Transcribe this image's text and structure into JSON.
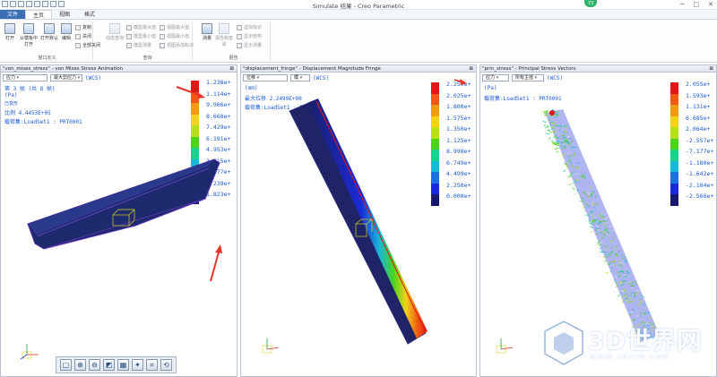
{
  "window": {
    "title": "Simulate 结果 - Creo Parametric",
    "badge": "73"
  },
  "tabs": [
    {
      "label": "文件"
    },
    {
      "label": "主页"
    },
    {
      "label": "视图"
    },
    {
      "label": "格式"
    }
  ],
  "ribbon": {
    "file_group": {
      "label": "窗口定义",
      "open": "打开",
      "open_from_template": "从模板中打开",
      "open_default": "打开默认",
      "edit": "编辑",
      "copy": "复制",
      "close": "关闭",
      "close_all": "全部关闭"
    },
    "query_group": {
      "label": "查询",
      "dynamic_query": "动态查询",
      "items": [
        "模型最大值",
        "模型最小值",
        "视图最大值",
        "视图最小值",
        "模型测量",
        "视图添加标识"
      ]
    },
    "report_group": {
      "label": "报告",
      "measure": "测量",
      "items": [
        "虚拟标识",
        "报告和查询",
        "显示结构",
        "显示测量"
      ]
    }
  },
  "panels": [
    {
      "title": "\"von_mises_stress\" - von Mises Stress Animation",
      "quantity": "应力",
      "component": "最大剪应力",
      "wcs": "(WCS)",
      "info_lines": [
        "第 3 帧 (共 8 帧)",
        "(Pa)",
        "已变形",
        "比例  4.4453E+05",
        "载荷集:LoadSet1 :  PRT0001"
      ],
      "legend_values": [
        "1.238e+",
        "1.114e+",
        "9.906e+",
        "8.668e+",
        "7.429e+",
        "6.191e+",
        "4.953e+",
        "3.715e+",
        "2.477e+",
        "1.239e+",
        "1.823e+"
      ]
    },
    {
      "title": "\"displacement_fringe\" - Displacement Magnitude Fringe",
      "quantity": "位移",
      "component": "模",
      "wcs": "(WCS)",
      "info_lines": [
        "(mm)",
        "最大位移 2.2499E+00",
        "载荷集:LoadSet1 :  PRT0001"
      ],
      "legend_values": [
        "2.250e+",
        "2.025e+",
        "1.800e+",
        "1.575e+",
        "1.350e+",
        "1.125e+",
        "8.998e+",
        "6.749e+",
        "4.499e+",
        "2.250e+",
        "0.000e+"
      ]
    },
    {
      "title": "\"prin_stress\" - Principal Stress Vectors",
      "quantity": "应力",
      "component": "所有主值",
      "wcs": "(WCS)",
      "info_lines": [
        "(Pa)",
        "载荷集:LoadSet1 :  PRT0001"
      ],
      "legend_values": [
        "2.055e+",
        "1.593e+",
        "1.131e+",
        "6.685e+",
        "2.064e+",
        "-2.557e+",
        "-7.177e+",
        "-1.180e+",
        "-1.642e+",
        "-2.104e+",
        "-2.566e+"
      ]
    }
  ],
  "legend_colors": [
    "#e01818",
    "#f05a12",
    "#f29a12",
    "#f2d21a",
    "#b8e01a",
    "#4cd41a",
    "#1ad28c",
    "#18b8d8",
    "#1a72e0",
    "#1a2ad8",
    "#16186e"
  ],
  "watermark": {
    "text": "3D世界网",
    "sub": "WWW.3DSJW.COM"
  }
}
